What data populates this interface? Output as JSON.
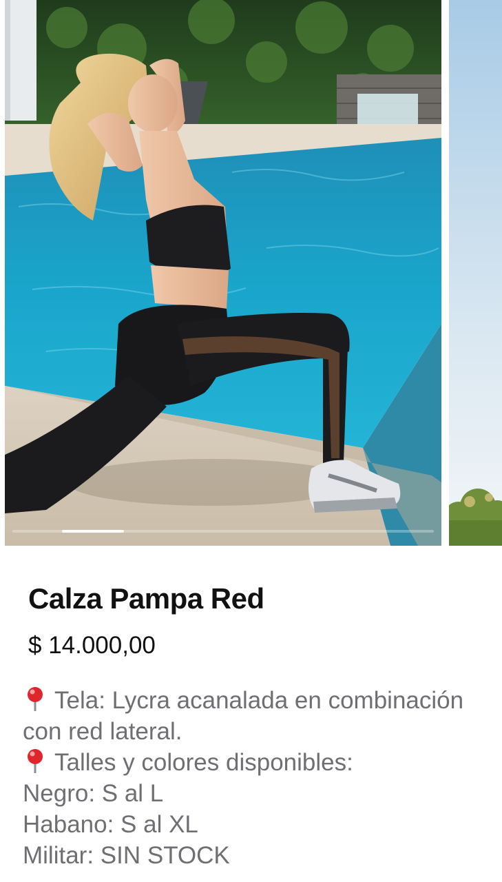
{
  "gallery": {
    "image_alt": "Modelo con calza negra y top junto a una piscina",
    "next_image_alt": "Vista parcial de la siguiente foto",
    "active_index": 1,
    "slide_count": 4
  },
  "product": {
    "title": "Calza Pampa Red",
    "price": "$ 14.000,00"
  },
  "description": {
    "icon": "round-pushpin-icon",
    "lines": [
      {
        "has_pin": true,
        "text": "Tela: Lycra acanalada en combinación"
      },
      {
        "has_pin": false,
        "text": "con red lateral."
      },
      {
        "has_pin": true,
        "text": "Talles y colores disponibles:"
      },
      {
        "has_pin": false,
        "text": "Negro: S al L"
      },
      {
        "has_pin": false,
        "text": "Habano: S al XL"
      },
      {
        "has_pin": false,
        "text": "Militar: SIN STOCK"
      }
    ]
  },
  "colors": {
    "pool": "#1aa3c9",
    "text_primary": "#111111",
    "text_secondary": "#6e6e73",
    "pin_red": "#e0262d"
  }
}
